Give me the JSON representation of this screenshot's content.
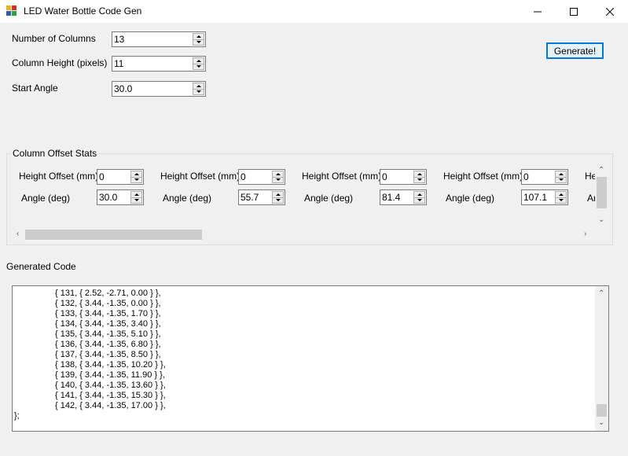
{
  "window": {
    "title": "LED Water Bottle Code Gen",
    "icon": "app-grid-icon",
    "controls": [
      "minimize-icon",
      "maximize-icon",
      "close-icon"
    ]
  },
  "settings": {
    "columns_label": "Number of Columns",
    "columns_value": "13",
    "height_label": "Column Height (pixels)",
    "height_value": "11",
    "angle_label": "Start Angle",
    "angle_value": "30.0"
  },
  "generate_label": "Generate!",
  "offsets": {
    "title": "Column Offset Stats",
    "height_label": "Height Offset (mm)",
    "angle_label": "Angle (deg)",
    "columns": [
      {
        "height": "0",
        "angle": "30.0"
      },
      {
        "height": "0",
        "angle": "55.7"
      },
      {
        "height": "0",
        "angle": "81.4"
      },
      {
        "height": "0",
        "angle": "107.1"
      }
    ],
    "partial_height_label": "He",
    "partial_angle_label": "Ar"
  },
  "code": {
    "label": "Generated Code",
    "lines": [
      "{ 131, { 2.52, -2.71, 0.00 } },",
      "{ 132, { 3.44, -1.35, 0.00 } },",
      "{ 133, { 3.44, -1.35, 1.70 } },",
      "{ 134, { 3.44, -1.35, 3.40 } },",
      "{ 135, { 3.44, -1.35, 5.10 } },",
      "{ 136, { 3.44, -1.35, 6.80 } },",
      "{ 137, { 3.44, -1.35, 8.50 } },",
      "{ 138, { 3.44, -1.35, 10.20 } },",
      "{ 139, { 3.44, -1.35, 11.90 } },",
      "{ 140, { 3.44, -1.35, 13.60 } },",
      "{ 141, { 3.44, -1.35, 15.30 } },",
      "{ 142, { 3.44, -1.35, 17.00 } },"
    ],
    "closing": "};"
  },
  "colors": {
    "accent": "#0078d7",
    "window_bg": "#f0f0f0",
    "scroll_thumb": "#cdcdcd"
  }
}
